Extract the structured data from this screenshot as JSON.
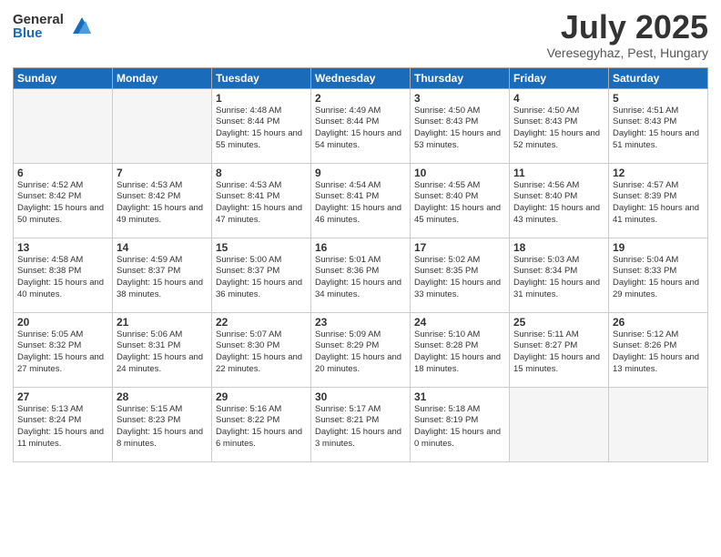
{
  "header": {
    "logo_general": "General",
    "logo_blue": "Blue",
    "month_title": "July 2025",
    "location": "Veresegyhaz, Pest, Hungary"
  },
  "days_of_week": [
    "Sunday",
    "Monday",
    "Tuesday",
    "Wednesday",
    "Thursday",
    "Friday",
    "Saturday"
  ],
  "weeks": [
    [
      {
        "day": "",
        "info": ""
      },
      {
        "day": "",
        "info": ""
      },
      {
        "day": "1",
        "info": "Sunrise: 4:48 AM\nSunset: 8:44 PM\nDaylight: 15 hours\nand 55 minutes."
      },
      {
        "day": "2",
        "info": "Sunrise: 4:49 AM\nSunset: 8:44 PM\nDaylight: 15 hours\nand 54 minutes."
      },
      {
        "day": "3",
        "info": "Sunrise: 4:50 AM\nSunset: 8:43 PM\nDaylight: 15 hours\nand 53 minutes."
      },
      {
        "day": "4",
        "info": "Sunrise: 4:50 AM\nSunset: 8:43 PM\nDaylight: 15 hours\nand 52 minutes."
      },
      {
        "day": "5",
        "info": "Sunrise: 4:51 AM\nSunset: 8:43 PM\nDaylight: 15 hours\nand 51 minutes."
      }
    ],
    [
      {
        "day": "6",
        "info": "Sunrise: 4:52 AM\nSunset: 8:42 PM\nDaylight: 15 hours\nand 50 minutes."
      },
      {
        "day": "7",
        "info": "Sunrise: 4:53 AM\nSunset: 8:42 PM\nDaylight: 15 hours\nand 49 minutes."
      },
      {
        "day": "8",
        "info": "Sunrise: 4:53 AM\nSunset: 8:41 PM\nDaylight: 15 hours\nand 47 minutes."
      },
      {
        "day": "9",
        "info": "Sunrise: 4:54 AM\nSunset: 8:41 PM\nDaylight: 15 hours\nand 46 minutes."
      },
      {
        "day": "10",
        "info": "Sunrise: 4:55 AM\nSunset: 8:40 PM\nDaylight: 15 hours\nand 45 minutes."
      },
      {
        "day": "11",
        "info": "Sunrise: 4:56 AM\nSunset: 8:40 PM\nDaylight: 15 hours\nand 43 minutes."
      },
      {
        "day": "12",
        "info": "Sunrise: 4:57 AM\nSunset: 8:39 PM\nDaylight: 15 hours\nand 41 minutes."
      }
    ],
    [
      {
        "day": "13",
        "info": "Sunrise: 4:58 AM\nSunset: 8:38 PM\nDaylight: 15 hours\nand 40 minutes."
      },
      {
        "day": "14",
        "info": "Sunrise: 4:59 AM\nSunset: 8:37 PM\nDaylight: 15 hours\nand 38 minutes."
      },
      {
        "day": "15",
        "info": "Sunrise: 5:00 AM\nSunset: 8:37 PM\nDaylight: 15 hours\nand 36 minutes."
      },
      {
        "day": "16",
        "info": "Sunrise: 5:01 AM\nSunset: 8:36 PM\nDaylight: 15 hours\nand 34 minutes."
      },
      {
        "day": "17",
        "info": "Sunrise: 5:02 AM\nSunset: 8:35 PM\nDaylight: 15 hours\nand 33 minutes."
      },
      {
        "day": "18",
        "info": "Sunrise: 5:03 AM\nSunset: 8:34 PM\nDaylight: 15 hours\nand 31 minutes."
      },
      {
        "day": "19",
        "info": "Sunrise: 5:04 AM\nSunset: 8:33 PM\nDaylight: 15 hours\nand 29 minutes."
      }
    ],
    [
      {
        "day": "20",
        "info": "Sunrise: 5:05 AM\nSunset: 8:32 PM\nDaylight: 15 hours\nand 27 minutes."
      },
      {
        "day": "21",
        "info": "Sunrise: 5:06 AM\nSunset: 8:31 PM\nDaylight: 15 hours\nand 24 minutes."
      },
      {
        "day": "22",
        "info": "Sunrise: 5:07 AM\nSunset: 8:30 PM\nDaylight: 15 hours\nand 22 minutes."
      },
      {
        "day": "23",
        "info": "Sunrise: 5:09 AM\nSunset: 8:29 PM\nDaylight: 15 hours\nand 20 minutes."
      },
      {
        "day": "24",
        "info": "Sunrise: 5:10 AM\nSunset: 8:28 PM\nDaylight: 15 hours\nand 18 minutes."
      },
      {
        "day": "25",
        "info": "Sunrise: 5:11 AM\nSunset: 8:27 PM\nDaylight: 15 hours\nand 15 minutes."
      },
      {
        "day": "26",
        "info": "Sunrise: 5:12 AM\nSunset: 8:26 PM\nDaylight: 15 hours\nand 13 minutes."
      }
    ],
    [
      {
        "day": "27",
        "info": "Sunrise: 5:13 AM\nSunset: 8:24 PM\nDaylight: 15 hours\nand 11 minutes."
      },
      {
        "day": "28",
        "info": "Sunrise: 5:15 AM\nSunset: 8:23 PM\nDaylight: 15 hours\nand 8 minutes."
      },
      {
        "day": "29",
        "info": "Sunrise: 5:16 AM\nSunset: 8:22 PM\nDaylight: 15 hours\nand 6 minutes."
      },
      {
        "day": "30",
        "info": "Sunrise: 5:17 AM\nSunset: 8:21 PM\nDaylight: 15 hours\nand 3 minutes."
      },
      {
        "day": "31",
        "info": "Sunrise: 5:18 AM\nSunset: 8:19 PM\nDaylight: 15 hours\nand 0 minutes."
      },
      {
        "day": "",
        "info": ""
      },
      {
        "day": "",
        "info": ""
      }
    ]
  ]
}
